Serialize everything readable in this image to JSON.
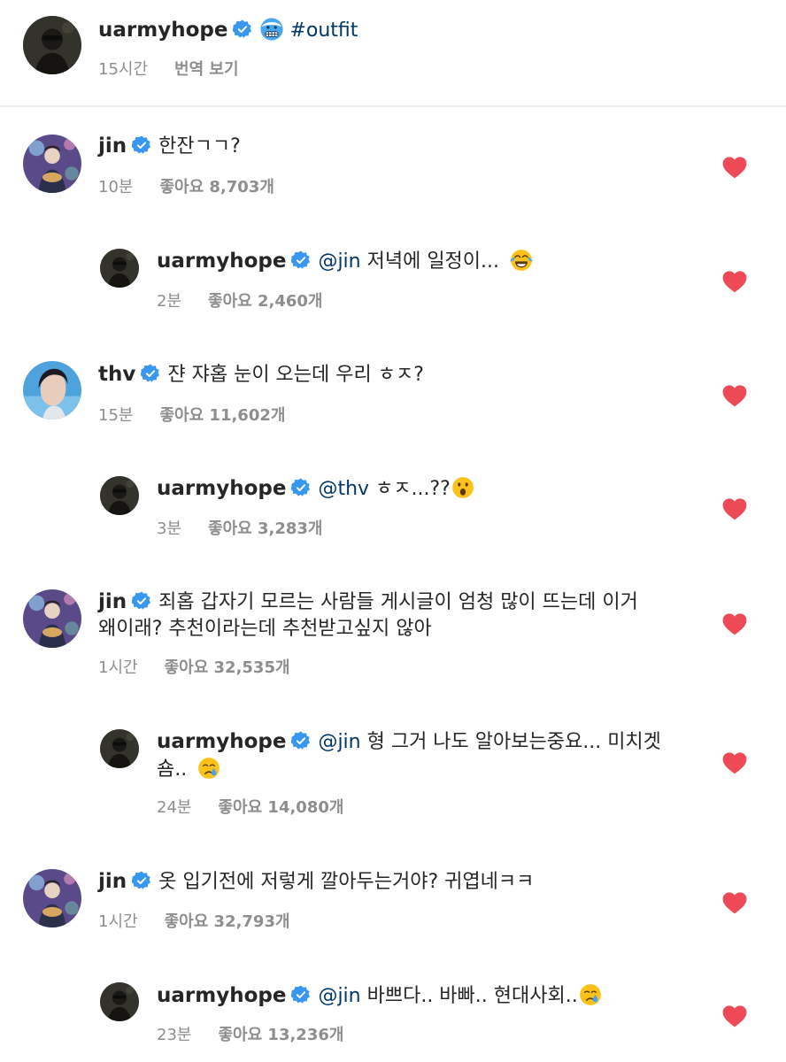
{
  "caption": {
    "username": "uarmyhope",
    "hashtag": "#outfit",
    "emoji": "freezing-face-emoji",
    "time": "15시간",
    "translate_label": "번역 보기"
  },
  "comments": [
    {
      "username": "jin",
      "text_line1": "한잔ㄱㄱ?",
      "text_line2": "",
      "mention": "",
      "emoji": "",
      "time": "10분",
      "likes": "좋아요 8,703개",
      "reply": false,
      "avatar": "jin-avatar"
    },
    {
      "username": "uarmyhope",
      "mention": "@jin",
      "text_line1": " 저녁에 일정이... ",
      "text_line2": "",
      "emoji": "tears-of-joy-emoji",
      "time": "2분",
      "likes": "좋아요 2,460개",
      "reply": true,
      "avatar": "uarmyhope-avatar"
    },
    {
      "username": "thv",
      "text_line1": "쟌 쟈홉 눈이 오는데 우리 ㅎㅈ?",
      "text_line2": "",
      "mention": "",
      "emoji": "",
      "time": "15분",
      "likes": "좋아요 11,602개",
      "reply": false,
      "avatar": "thv-avatar"
    },
    {
      "username": "uarmyhope",
      "mention": "@thv",
      "text_line1": " ㅎㅈ...??",
      "text_line2": "",
      "emoji": "surprised-face-emoji",
      "time": "3분",
      "likes": "좋아요 3,283개",
      "reply": true,
      "avatar": "uarmyhope-avatar"
    },
    {
      "username": "jin",
      "text_line1": "죄홉 갑자기 모르는 사람들 게시글이 엄청 많이 뜨는데 이거",
      "text_line2": "왜이래? 추천이라는데 추천받고싶지 않아",
      "mention": "",
      "emoji": "",
      "time": "1시간",
      "likes": "좋아요 32,535개",
      "reply": false,
      "avatar": "jin-avatar"
    },
    {
      "username": "uarmyhope",
      "mention": "@jin",
      "text_line1": " 형 그거 나도 알아보는중요... 미치겟",
      "text_line2": "숌.. ",
      "emoji": "crying-face-emoji",
      "time": "24분",
      "likes": "좋아요 14,080개",
      "reply": true,
      "avatar": "uarmyhope-avatar"
    },
    {
      "username": "jin",
      "text_line1": "옷 입기전에 저렇게 깔아두는거야? 귀엽네ㅋㅋ",
      "text_line2": "",
      "mention": "",
      "emoji": "",
      "time": "1시간",
      "likes": "좋아요 32,793개",
      "reply": false,
      "avatar": "jin-avatar"
    },
    {
      "username": "uarmyhope",
      "mention": "@jin",
      "text_line1": " 바쁘다.. 바빠.. 현대사회..",
      "text_line2": "",
      "emoji": "crying-face-emoji",
      "time": "23분",
      "likes": "좋아요 13,236개",
      "reply": true,
      "avatar": "uarmyhope-avatar"
    }
  ],
  "colors": {
    "heart": "#ed4956",
    "verified": "#3897f0",
    "mention": "#00376b",
    "meta": "#8e8e8e"
  }
}
